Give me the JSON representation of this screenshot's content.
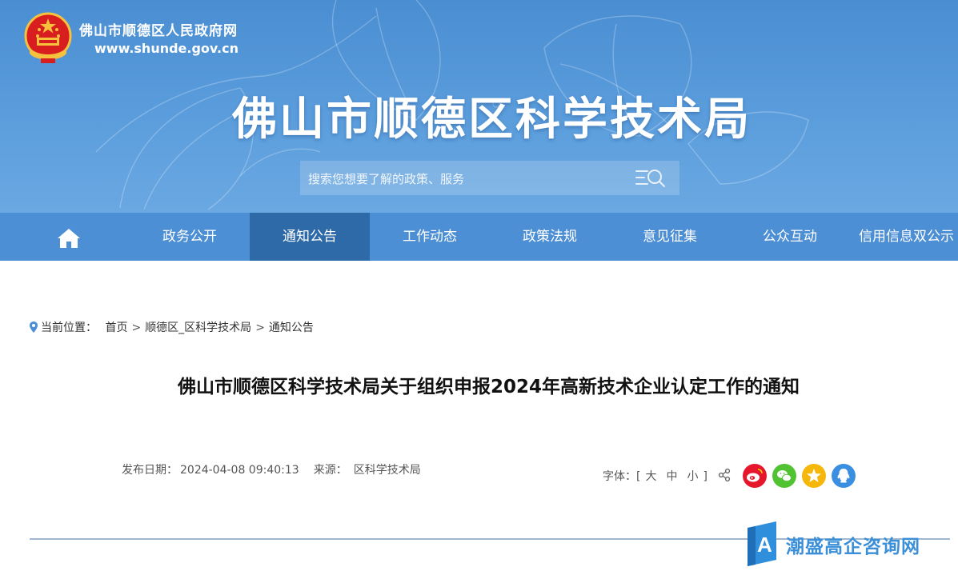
{
  "header": {
    "site_name": "佛山市顺德区人民政府网",
    "site_url": "www.shunde.gov.cn",
    "bureau_title": "佛山市顺德区科学技术局",
    "search_placeholder": "搜索您想要了解的政策、服务"
  },
  "nav": {
    "home_icon": "home-icon",
    "items": [
      {
        "label": "政务公开",
        "active": false
      },
      {
        "label": "通知公告",
        "active": true
      },
      {
        "label": "工作动态",
        "active": false
      },
      {
        "label": "政策法规",
        "active": false
      },
      {
        "label": "意见征集",
        "active": false
      },
      {
        "label": "公众互动",
        "active": false
      },
      {
        "label": "信用信息双公示",
        "active": false
      }
    ]
  },
  "breadcrumb": {
    "prefix": "当前位置：",
    "items": [
      "首页",
      "顺德区_区科学技术局",
      "通知公告"
    ],
    "separator": ">"
  },
  "article": {
    "title": "佛山市顺德区科学技术局关于组织申报2024年高新技术企业认定工作的通知",
    "publish_label": "发布日期：",
    "publish_date": "2024-04-08 09:40:13",
    "source_label": "来源：",
    "source": "区科学技术局"
  },
  "font_size": {
    "label": "字体：[",
    "large": "大",
    "medium": "中",
    "small": "小",
    "close": "]"
  },
  "share": [
    "weibo-icon",
    "wechat-icon",
    "qzone-icon",
    "qq-icon"
  ],
  "watermark": {
    "logo_letter": "A",
    "text": "潮盛高企咨询网"
  },
  "colors": {
    "banner": "#4a8ed2",
    "nav": "#4d8fd4",
    "nav_active": "#2f6aa8",
    "weibo": "#e6162d",
    "wechat": "#51c332",
    "qzone": "#f5b70a",
    "qq": "#3b8fe0",
    "watermark": "#3a8fd8"
  }
}
